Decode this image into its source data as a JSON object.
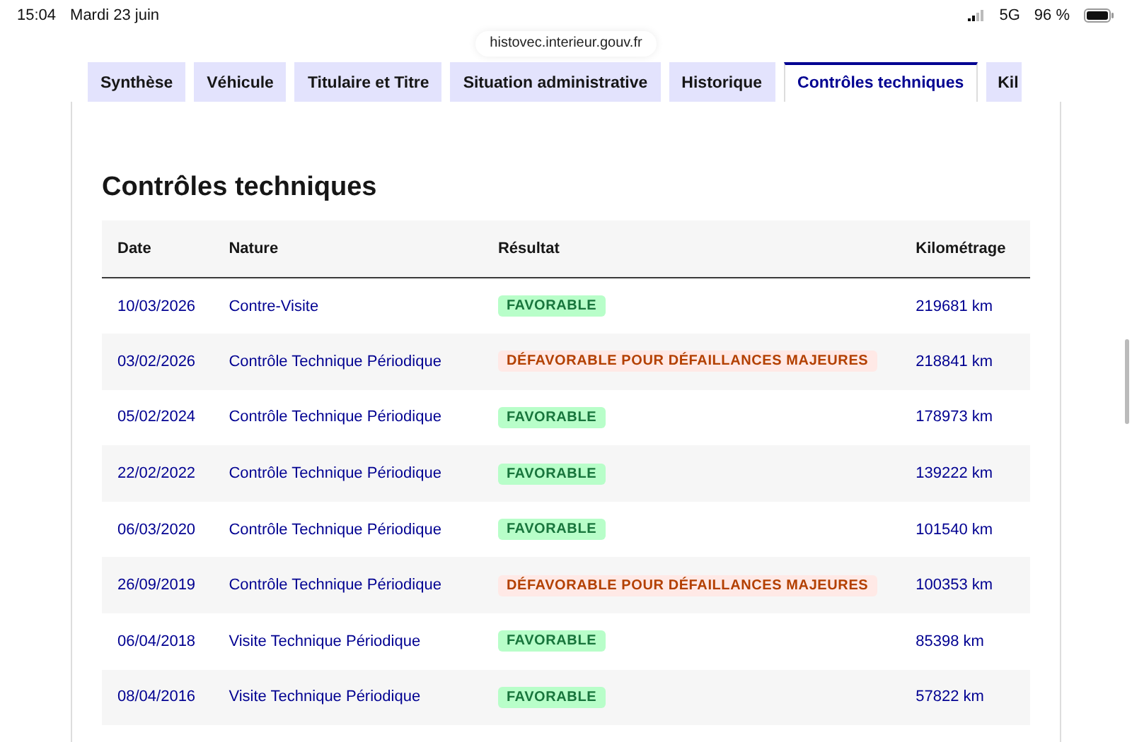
{
  "status_bar": {
    "time": "15:04",
    "date": "Mardi 23 juin",
    "network": "5G",
    "battery": "96 %"
  },
  "address_bar": {
    "url": "histovec.interieur.gouv.fr"
  },
  "tabs": [
    {
      "label": "Synthèse",
      "selected": false
    },
    {
      "label": "Véhicule",
      "selected": false
    },
    {
      "label": "Titulaire et Titre",
      "selected": false
    },
    {
      "label": "Situation administrative",
      "selected": false
    },
    {
      "label": "Historique",
      "selected": false
    },
    {
      "label": "Contrôles techniques",
      "selected": true
    },
    {
      "label": "Kil",
      "selected": false
    }
  ],
  "section": {
    "title": "Contrôles techniques"
  },
  "table": {
    "columns": [
      "Date",
      "Nature",
      "Résultat",
      "Kilométrage"
    ],
    "rows": [
      {
        "date": "10/03/2026",
        "nature": "Contre-Visite",
        "result": {
          "label": "FAVORABLE",
          "kind": "favorable"
        },
        "mileage": "219681 km"
      },
      {
        "date": "03/02/2026",
        "nature": "Contrôle Technique Périodique",
        "result": {
          "label": "DÉFAVORABLE POUR DÉFAILLANCES MAJEURES",
          "kind": "defavorable"
        },
        "mileage": "218841 km"
      },
      {
        "date": "05/02/2024",
        "nature": "Contrôle Technique Périodique",
        "result": {
          "label": "FAVORABLE",
          "kind": "favorable"
        },
        "mileage": "178973 km"
      },
      {
        "date": "22/02/2022",
        "nature": "Contrôle Technique Périodique",
        "result": {
          "label": "FAVORABLE",
          "kind": "favorable"
        },
        "mileage": "139222 km"
      },
      {
        "date": "06/03/2020",
        "nature": "Contrôle Technique Périodique",
        "result": {
          "label": "FAVORABLE",
          "kind": "favorable"
        },
        "mileage": "101540 km"
      },
      {
        "date": "26/09/2019",
        "nature": "Contrôle Technique Périodique",
        "result": {
          "label": "DÉFAVORABLE POUR DÉFAILLANCES MAJEURES",
          "kind": "defavorable"
        },
        "mileage": "100353 km"
      },
      {
        "date": "06/04/2018",
        "nature": "Visite Technique Périodique",
        "result": {
          "label": "FAVORABLE",
          "kind": "favorable"
        },
        "mileage": "85398 km"
      },
      {
        "date": "08/04/2016",
        "nature": "Visite Technique Périodique",
        "result": {
          "label": "FAVORABLE",
          "kind": "favorable"
        },
        "mileage": "57822 km"
      }
    ]
  }
}
